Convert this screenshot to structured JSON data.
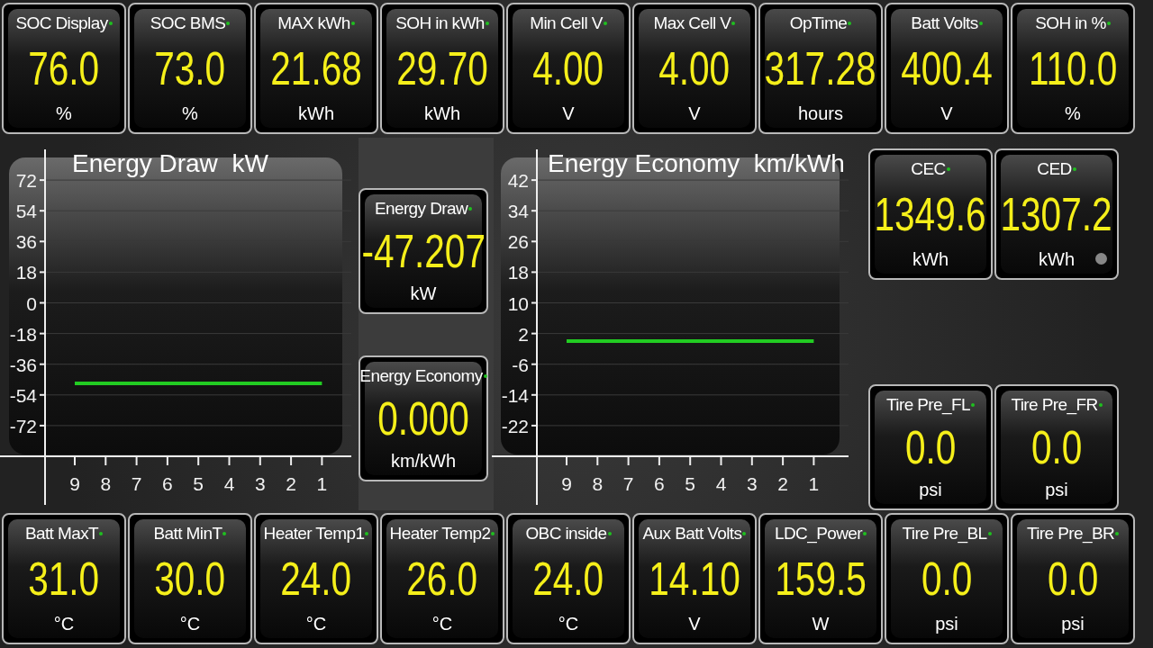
{
  "top_gauges": [
    {
      "label": "SOC Display",
      "value": "76.0",
      "unit": "%"
    },
    {
      "label": "SOC BMS",
      "value": "73.0",
      "unit": "%"
    },
    {
      "label": "MAX kWh",
      "value": "21.68",
      "unit": "kWh"
    },
    {
      "label": "SOH in kWh",
      "value": "29.70",
      "unit": "kWh"
    },
    {
      "label": "Min Cell V",
      "value": "4.00",
      "unit": "V"
    },
    {
      "label": "Max Cell V",
      "value": "4.00",
      "unit": "V"
    },
    {
      "label": "OpTime",
      "value": "317.28",
      "unit": "hours"
    },
    {
      "label": "Batt Volts",
      "value": "400.4",
      "unit": "V"
    },
    {
      "label": "SOH in %",
      "value": "110.0",
      "unit": "%"
    }
  ],
  "charts": [
    {
      "chart_data": {
        "type": "line",
        "title": "Energy Draw  kW",
        "categories": [
          "9",
          "8",
          "7",
          "6",
          "5",
          "4",
          "3",
          "2",
          "1"
        ],
        "series": [
          {
            "color": "#22cc22",
            "values": [
              -47.2,
              -47.2,
              -47.2,
              -47.2,
              -47.2,
              -47.2,
              -47.2,
              -47.2,
              -47.2
            ]
          }
        ],
        "ylim": [
          -90,
          90
        ],
        "yticks": [
          72,
          54,
          36,
          18,
          0,
          -18,
          -36,
          -54,
          -72
        ],
        "grid": true
      }
    },
    {
      "chart_data": {
        "type": "line",
        "title": "Energy Economy  km/kWh",
        "categories": [
          "9",
          "8",
          "7",
          "6",
          "5",
          "4",
          "3",
          "2",
          "1"
        ],
        "series": [
          {
            "color": "#22cc22",
            "values": [
              0,
              0,
              0,
              0,
              0,
              0,
              0,
              0,
              0
            ]
          }
        ],
        "ylim": [
          -30,
          50
        ],
        "yticks": [
          42,
          34,
          26,
          18,
          10,
          2,
          -6,
          -14,
          -22
        ],
        "grid": true
      }
    }
  ],
  "center_gauges": [
    {
      "label": "Energy Draw",
      "value": "-47.207",
      "unit": "kW"
    },
    {
      "label": "Energy Economy",
      "value": "0.000",
      "unit": "km/kWh"
    }
  ],
  "right_top_gauges": [
    {
      "label": "CEC",
      "value": "1349.6",
      "unit": "kWh"
    },
    {
      "label": "CED",
      "value": "1307.2",
      "unit": "kWh"
    }
  ],
  "right_bottom_gauges": [
    {
      "label": "Tire Pre_FL",
      "value": "0.0",
      "unit": "psi"
    },
    {
      "label": "Tire Pre_FR",
      "value": "0.0",
      "unit": "psi"
    }
  ],
  "bottom_gauges": [
    {
      "label": "Batt MaxT",
      "value": "31.0",
      "unit": "°C"
    },
    {
      "label": "Batt MinT",
      "value": "30.0",
      "unit": "°C"
    },
    {
      "label": "Heater Temp1",
      "value": "24.0",
      "unit": "°C"
    },
    {
      "label": "Heater Temp2",
      "value": "26.0",
      "unit": "°C"
    },
    {
      "label": "OBC inside",
      "value": "24.0",
      "unit": "°C"
    },
    {
      "label": "Aux Batt Volts",
      "value": "14.10",
      "unit": "V"
    },
    {
      "label": "LDC_Power",
      "value": "159.5",
      "unit": "W"
    },
    {
      "label": "Tire Pre_BL",
      "value": "0.0",
      "unit": "psi"
    },
    {
      "label": "Tire Pre_BR",
      "value": "0.0",
      "unit": "psi"
    }
  ]
}
